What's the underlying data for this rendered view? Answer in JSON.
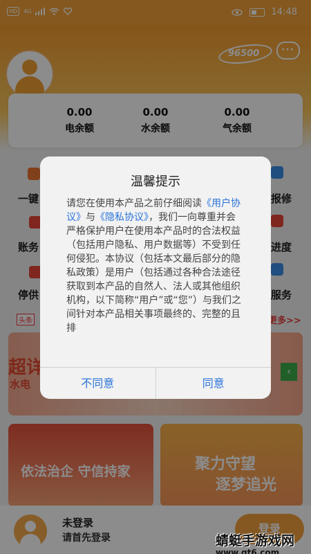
{
  "status_bar": {
    "left_badge": "HD",
    "network": "4G",
    "time": "14:48"
  },
  "header": {
    "hotline": "96500"
  },
  "balances": [
    {
      "value": "0.00",
      "label": "电余额"
    },
    {
      "value": "0.00",
      "label": "水余额"
    },
    {
      "value": "0.00",
      "label": "气余额"
    }
  ],
  "grid_partial": {
    "row1_left": "一键",
    "row1_right": "报修",
    "row2_left": "账务",
    "row2_right": "进度",
    "row3_left": "停供",
    "row3_right": "服务"
  },
  "news": {
    "tag": "头条",
    "more": "更多>>"
  },
  "banner": {
    "big": "超详",
    "sub": "水电"
  },
  "cards": {
    "left": "依法治企 守信持家",
    "right_line1": "聚力守望",
    "right_line2": "逐梦追光"
  },
  "bottom": {
    "title": "未登录",
    "subtitle": "请首先登录",
    "login_button": "登录"
  },
  "watermark": {
    "line1": "蜻蜓手游戏网",
    "line2": "www.qt6.com"
  },
  "dialog": {
    "title": "温馨提示",
    "p_intro": "请您在使用本产品之前仔细阅读",
    "link_user": "《用户协议》",
    "and": "与",
    "link_privacy": "《隐私协议》",
    "p_rest": "，我们一向尊重并会严格保护用户在使用本产品时的合法权益（包括用户隐私、用户数据等）不受到任何侵犯。本协议（包括本文最后部分的隐私政策）是用户（包括通过各种合法途径获取到本产品的自然人、法人或其他组织机构，以下简称“用户”或“您”）与我们之间针对本产品相关事项最终的、完整的且排",
    "disagree": "不同意",
    "agree": "同意"
  }
}
